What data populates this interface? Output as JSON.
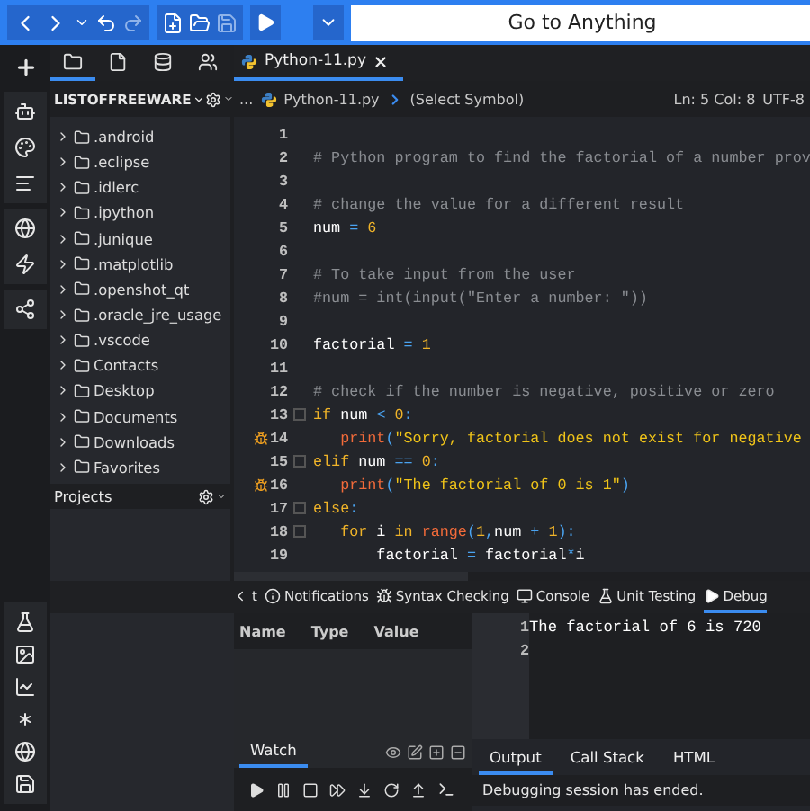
{
  "toolbar": {
    "search": {
      "placeholder": "Go to Anything"
    }
  },
  "sidebar": {
    "tabs": [
      {
        "kind": "folder",
        "selected": true
      },
      {
        "kind": "file",
        "selected": false
      },
      {
        "kind": "database",
        "selected": false
      },
      {
        "kind": "people",
        "selected": false
      }
    ],
    "places_title": "LISTOFFREEWARE",
    "tree": [
      {
        "label": ".android",
        "expanded": false
      },
      {
        "label": ".eclipse",
        "expanded": false
      },
      {
        "label": ".idlerc",
        "expanded": false
      },
      {
        "label": ".ipython",
        "expanded": false
      },
      {
        "label": ".junique",
        "expanded": false
      },
      {
        "label": ".matplotlib",
        "expanded": false
      },
      {
        "label": ".openshot_qt",
        "expanded": false
      },
      {
        "label": ".oracle_jre_usage",
        "expanded": false
      },
      {
        "label": ".vscode",
        "expanded": false
      },
      {
        "label": "Contacts",
        "expanded": false
      },
      {
        "label": "Desktop",
        "expanded": false
      },
      {
        "label": "Documents",
        "expanded": false
      },
      {
        "label": "Downloads",
        "expanded": false
      },
      {
        "label": "Favorites",
        "expanded": false
      }
    ],
    "projects_title": "Projects"
  },
  "editor": {
    "tabs": [
      {
        "label": "Python-11.py",
        "selected": true
      }
    ],
    "breadcrumb": {
      "ellipsis": "...",
      "file": "Python-11.py",
      "symbol": "(Select Symbol)",
      "position": "Ln: 5 Col: 8",
      "encoding": "UTF-8"
    },
    "lines": [
      {
        "number": "1"
      },
      {
        "number": "2",
        "tokens": [
          {
            "kind": "comment",
            "text": "# Python program to find the factorial of a number prov"
          }
        ]
      },
      {
        "number": "3"
      },
      {
        "number": "4",
        "tokens": [
          {
            "kind": "comment",
            "text": "# change the value for a different result"
          }
        ]
      },
      {
        "number": "5",
        "tokens": [
          {
            "kind": "name",
            "text": "num"
          },
          {
            "kind": "op",
            "text": " = "
          },
          {
            "kind": "number",
            "text": "6"
          }
        ]
      },
      {
        "number": "6"
      },
      {
        "number": "7",
        "tokens": [
          {
            "kind": "comment",
            "text": "# To take input from the user"
          }
        ]
      },
      {
        "number": "8",
        "tokens": [
          {
            "kind": "comment",
            "text": "#num = int(input(\"Enter a number: \"))"
          }
        ]
      },
      {
        "number": "9"
      },
      {
        "number": "10",
        "tokens": [
          {
            "kind": "name",
            "text": "factorial"
          },
          {
            "kind": "op",
            "text": " = "
          },
          {
            "kind": "number",
            "text": "1"
          }
        ]
      },
      {
        "number": "11"
      },
      {
        "number": "12",
        "tokens": [
          {
            "kind": "comment",
            "text": "# check if the number is negative, positive or zero"
          }
        ]
      },
      {
        "number": "13",
        "fold": true,
        "tokens": [
          {
            "kind": "keyword",
            "text": "if"
          },
          {
            "kind": "name",
            "text": " num "
          },
          {
            "kind": "op",
            "text": "< "
          },
          {
            "kind": "number",
            "text": "0"
          },
          {
            "kind": "op",
            "text": ":"
          }
        ]
      },
      {
        "number": "14",
        "breakpoint": true,
        "tokens": [
          {
            "kind": "builtin",
            "text": "   print"
          },
          {
            "kind": "op",
            "text": "("
          },
          {
            "kind": "string",
            "text": "\"Sorry, factorial does not exist for negative"
          }
        ]
      },
      {
        "number": "15",
        "fold": true,
        "tokens": [
          {
            "kind": "keyword",
            "text": "elif"
          },
          {
            "kind": "name",
            "text": " num "
          },
          {
            "kind": "op",
            "text": "== "
          },
          {
            "kind": "number",
            "text": "0"
          },
          {
            "kind": "op",
            "text": ":"
          }
        ]
      },
      {
        "number": "16",
        "breakpoint": true,
        "tokens": [
          {
            "kind": "builtin",
            "text": "   print"
          },
          {
            "kind": "op",
            "text": "("
          },
          {
            "kind": "string",
            "text": "\"The factorial of 0 is 1\""
          },
          {
            "kind": "op",
            "text": ")"
          }
        ]
      },
      {
        "number": "17",
        "fold": true,
        "tokens": [
          {
            "kind": "keyword",
            "text": "else"
          },
          {
            "kind": "op",
            "text": ":"
          }
        ]
      },
      {
        "number": "18",
        "fold": true,
        "tokens": [
          {
            "kind": "keyword",
            "text": "   for"
          },
          {
            "kind": "name",
            "text": " i "
          },
          {
            "kind": "keyword",
            "text": "in "
          },
          {
            "kind": "builtin",
            "text": "range"
          },
          {
            "kind": "op",
            "text": "("
          },
          {
            "kind": "number",
            "text": "1"
          },
          {
            "kind": "op",
            "text": ","
          },
          {
            "kind": "name",
            "text": "num"
          },
          {
            "kind": "op",
            "text": " + "
          },
          {
            "kind": "number",
            "text": "1"
          },
          {
            "kind": "op",
            "text": "):"
          }
        ]
      },
      {
        "number": "19",
        "tokens": [
          {
            "kind": "name",
            "text": "       factorial"
          },
          {
            "kind": "op",
            "text": " = "
          },
          {
            "kind": "name",
            "text": "factorial"
          },
          {
            "kind": "op",
            "text": "*"
          },
          {
            "kind": "name",
            "text": "i"
          }
        ]
      }
    ]
  },
  "bottom_panel": {
    "tabs": [
      {
        "label": "t",
        "kind": "cut",
        "selected": false
      },
      {
        "label": "Notifications",
        "kind": "info",
        "selected": false
      },
      {
        "label": "Syntax Checking",
        "kind": "syntax",
        "selected": false
      },
      {
        "label": "Console",
        "kind": "console",
        "selected": false
      },
      {
        "label": "Unit Testing",
        "kind": "flask",
        "selected": false
      },
      {
        "label": "Debug",
        "kind": "debug",
        "selected": true
      }
    ],
    "watch": {
      "columns": [
        "Name",
        "Type",
        "Value"
      ],
      "tabs": [
        {
          "label": "Watch",
          "selected": true
        }
      ]
    },
    "output": {
      "lines": [
        {
          "number": "1",
          "text": "The factorial of 6 is 720"
        },
        {
          "number": "2"
        }
      ],
      "tabs": [
        {
          "label": "Output",
          "selected": true
        },
        {
          "label": "Call Stack",
          "selected": false
        },
        {
          "label": "HTML",
          "selected": false
        }
      ],
      "status": "Debugging session has ended."
    }
  }
}
